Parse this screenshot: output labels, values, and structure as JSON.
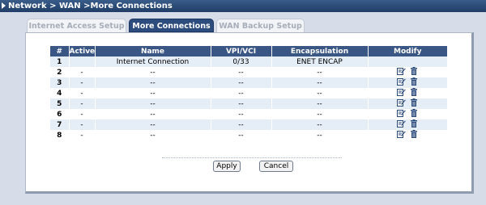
{
  "breadcrumb": "Network > WAN >More Connections",
  "tabs": [
    {
      "label": "Internet Access Setup",
      "active": false
    },
    {
      "label": "More Connections",
      "active": true
    },
    {
      "label": "WAN Backup Setup",
      "active": false
    }
  ],
  "table": {
    "headers": [
      "#",
      "Active",
      "Name",
      "VPI/VCI",
      "Encapsulation",
      "Modify"
    ],
    "rows": [
      {
        "num": "1",
        "active": "",
        "name": "Internet Connection",
        "vpivci": "0/33",
        "encap": "ENET ENCAP",
        "modify": false
      },
      {
        "num": "2",
        "active": "-",
        "name": "--",
        "vpivci": "--",
        "encap": "--",
        "modify": true
      },
      {
        "num": "3",
        "active": "-",
        "name": "--",
        "vpivci": "--",
        "encap": "--",
        "modify": true
      },
      {
        "num": "4",
        "active": "-",
        "name": "--",
        "vpivci": "--",
        "encap": "--",
        "modify": true
      },
      {
        "num": "5",
        "active": "-",
        "name": "--",
        "vpivci": "--",
        "encap": "--",
        "modify": true
      },
      {
        "num": "6",
        "active": "-",
        "name": "--",
        "vpivci": "--",
        "encap": "--",
        "modify": true
      },
      {
        "num": "7",
        "active": "-",
        "name": "--",
        "vpivci": "--",
        "encap": "--",
        "modify": true
      },
      {
        "num": "8",
        "active": "-",
        "name": "--",
        "vpivci": "--",
        "encap": "--",
        "modify": true
      }
    ]
  },
  "buttons": {
    "apply": "Apply",
    "cancel": "Cancel"
  },
  "icons": {
    "edit": "edit-icon",
    "delete": "trash-icon"
  },
  "colors": {
    "header": "#3a5685",
    "active_tab": "#2d4c7e",
    "row_alt": "#e5eef7"
  }
}
